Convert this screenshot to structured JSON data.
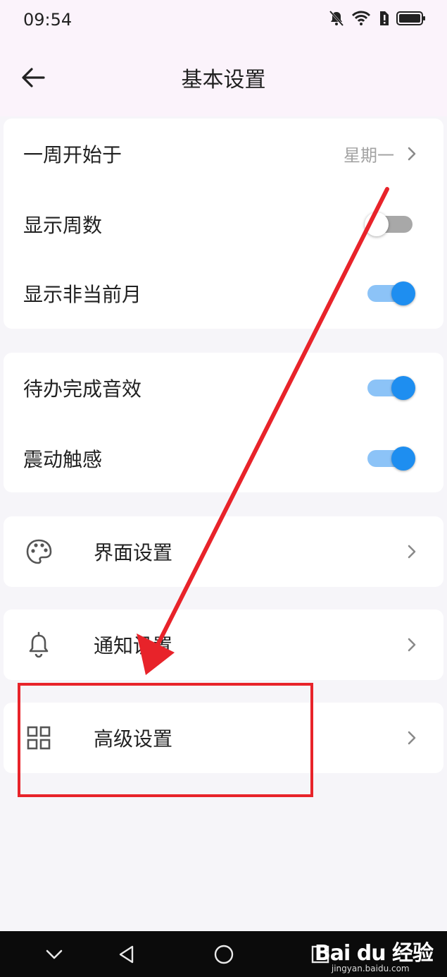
{
  "status_bar": {
    "time": "09:54"
  },
  "header": {
    "title": "基本设置"
  },
  "group1": {
    "week_start": {
      "label": "一周开始于",
      "value": "星期一"
    },
    "show_week_number": {
      "label": "显示周数",
      "enabled": false
    },
    "show_non_current_month": {
      "label": "显示非当前月",
      "enabled": true
    }
  },
  "group2": {
    "todo_sound": {
      "label": "待办完成音效",
      "enabled": true
    },
    "haptic": {
      "label": "震动触感",
      "enabled": true
    }
  },
  "interface_settings": {
    "label": "界面设置",
    "icon": "palette-icon"
  },
  "notification_settings": {
    "label": "通知设置",
    "icon": "bell-icon"
  },
  "advanced_settings": {
    "label": "高级设置",
    "icon": "grid-icon"
  },
  "watermark": {
    "main": "Bai du 经验",
    "sub": "jingyan.baidu.com"
  },
  "colors": {
    "accent": "#1e8ef0",
    "annotation": "#e8232a"
  }
}
